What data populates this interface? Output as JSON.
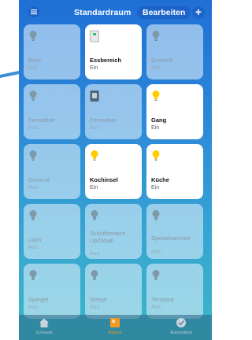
{
  "header": {
    "title": "Standardraum",
    "edit_label": "Bearbeiten",
    "add_label": "+"
  },
  "accessories": [
    {
      "name": "Büro",
      "status": "Aus",
      "icon": "bulb-icon",
      "on": false
    },
    {
      "name": "Essbereich",
      "status": "Ein",
      "icon": "switch-icon",
      "on": true
    },
    {
      "name": "Esstisch",
      "status": "Aus",
      "icon": "bulb-icon",
      "on": false
    },
    {
      "name": "Fernseher",
      "status": "Aus",
      "icon": "bulb-icon",
      "on": false
    },
    {
      "name": "Fernseher",
      "status": "Aus",
      "icon": "outlet-icon",
      "on": false
    },
    {
      "name": "Gang",
      "status": "Ein",
      "icon": "bulb-icon",
      "on": true
    },
    {
      "name": "General",
      "status": "Aus",
      "icon": "bulb-icon",
      "on": false
    },
    {
      "name": "Kochinsel",
      "status": "Ein",
      "icon": "bulb-icon",
      "on": true
    },
    {
      "name": "Küche",
      "status": "Ein",
      "icon": "bulb-icon",
      "on": true
    },
    {
      "name": "Liam",
      "status": "Aus",
      "icon": "bulb-icon",
      "on": false
    },
    {
      "name": "Schlafbereich Up/Down",
      "status": "Aus",
      "icon": "bulb-icon",
      "on": false
    },
    {
      "name": "Speisekammer",
      "status": "Aus",
      "icon": "bulb-icon",
      "on": false
    },
    {
      "name": "Spiegel",
      "status": "Aus",
      "icon": "bulb-icon",
      "on": false
    },
    {
      "name": "Stiege",
      "status": "Aus",
      "icon": "bulb-icon",
      "on": false
    },
    {
      "name": "Terrasse",
      "status": "Aus",
      "icon": "bulb-icon",
      "on": false
    }
  ],
  "tabbar": {
    "tabs": [
      {
        "label": "Zuhause",
        "icon": "home-icon",
        "active": false
      },
      {
        "label": "Räume",
        "icon": "rooms-icon",
        "active": true
      },
      {
        "label": "Automation",
        "icon": "automation-icon",
        "active": false
      }
    ]
  },
  "colors": {
    "bulb_on": "#ffcc00",
    "bulb_off": "#7e9aa8",
    "accent": "#f29a1f",
    "button_blue": "#1d63c8"
  }
}
